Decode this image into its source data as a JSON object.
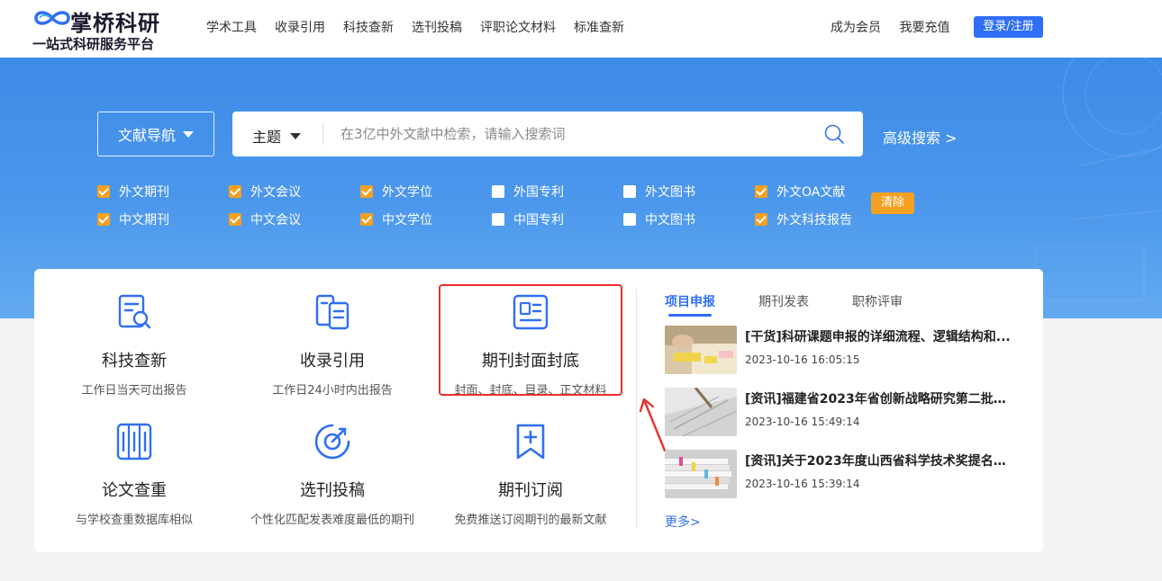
{
  "header": {
    "logo_title": "掌桥科研",
    "logo_subtitle": "一站式科研服务平台",
    "nav": [
      "学术工具",
      "收录引用",
      "科技查新",
      "选刊投稿",
      "评职论文材料",
      "标准查新"
    ],
    "become_member": "成为会员",
    "recharge": "我要充值",
    "login": "登录/注册"
  },
  "search": {
    "doc_nav": "文献导航",
    "topic": "主题",
    "placeholder": "在3亿中外文献中检索，请输入搜索词",
    "advanced": "高级搜索  >"
  },
  "filters": {
    "row1": [
      {
        "label": "外文期刊",
        "checked": true
      },
      {
        "label": "外文会议",
        "checked": true
      },
      {
        "label": "外文学位",
        "checked": true
      },
      {
        "label": "外国专利",
        "checked": false
      },
      {
        "label": "外文图书",
        "checked": false
      },
      {
        "label": "外文OA文献",
        "checked": true
      }
    ],
    "row2": [
      {
        "label": "中文期刊",
        "checked": true
      },
      {
        "label": "中文会议",
        "checked": true
      },
      {
        "label": "中文学位",
        "checked": true
      },
      {
        "label": "中国专利",
        "checked": false
      },
      {
        "label": "中文图书",
        "checked": false
      },
      {
        "label": "外文科技报告",
        "checked": true
      }
    ],
    "clear": "清除"
  },
  "services": [
    {
      "title": "科技查新",
      "desc": "工作日当天可出报告",
      "icon": "search-report-icon"
    },
    {
      "title": "收录引用",
      "desc": "工作日24小时内出报告",
      "icon": "documents-icon"
    },
    {
      "title": "期刊封面封底",
      "desc": "封面、封底、目录、正文材料",
      "icon": "journal-cover-icon"
    },
    {
      "title": "论文查重",
      "desc": "与学校查重数据库相似",
      "icon": "columns-icon"
    },
    {
      "title": "选刊投稿",
      "desc": "个性化匹配发表难度最低的期刊",
      "icon": "target-icon"
    },
    {
      "title": "期刊订阅",
      "desc": "免费推送订阅期刊的最新文献",
      "icon": "bookmark-icon"
    }
  ],
  "news": {
    "tabs": [
      "项目申报",
      "期刊发表",
      "职称评审"
    ],
    "items": [
      {
        "title": "[干货]科研课题申报的详细流程、逻辑结构和...",
        "date": "2023-10-16 16:05:15"
      },
      {
        "title": "[资讯]福建省2023年省创新战略研究第二批定...",
        "date": "2023-10-16 15:49:14"
      },
      {
        "title": "[资讯]关于2023年度山西省科学技术奖提名工...",
        "date": "2023-10-16 15:39:14"
      }
    ],
    "more": "更多>"
  },
  "colors": {
    "brand_blue": "#2f6ff5",
    "hero_blue": "#3d8be8",
    "checkbox_orange": "#f5a021",
    "highlight_red": "#e8312a"
  }
}
